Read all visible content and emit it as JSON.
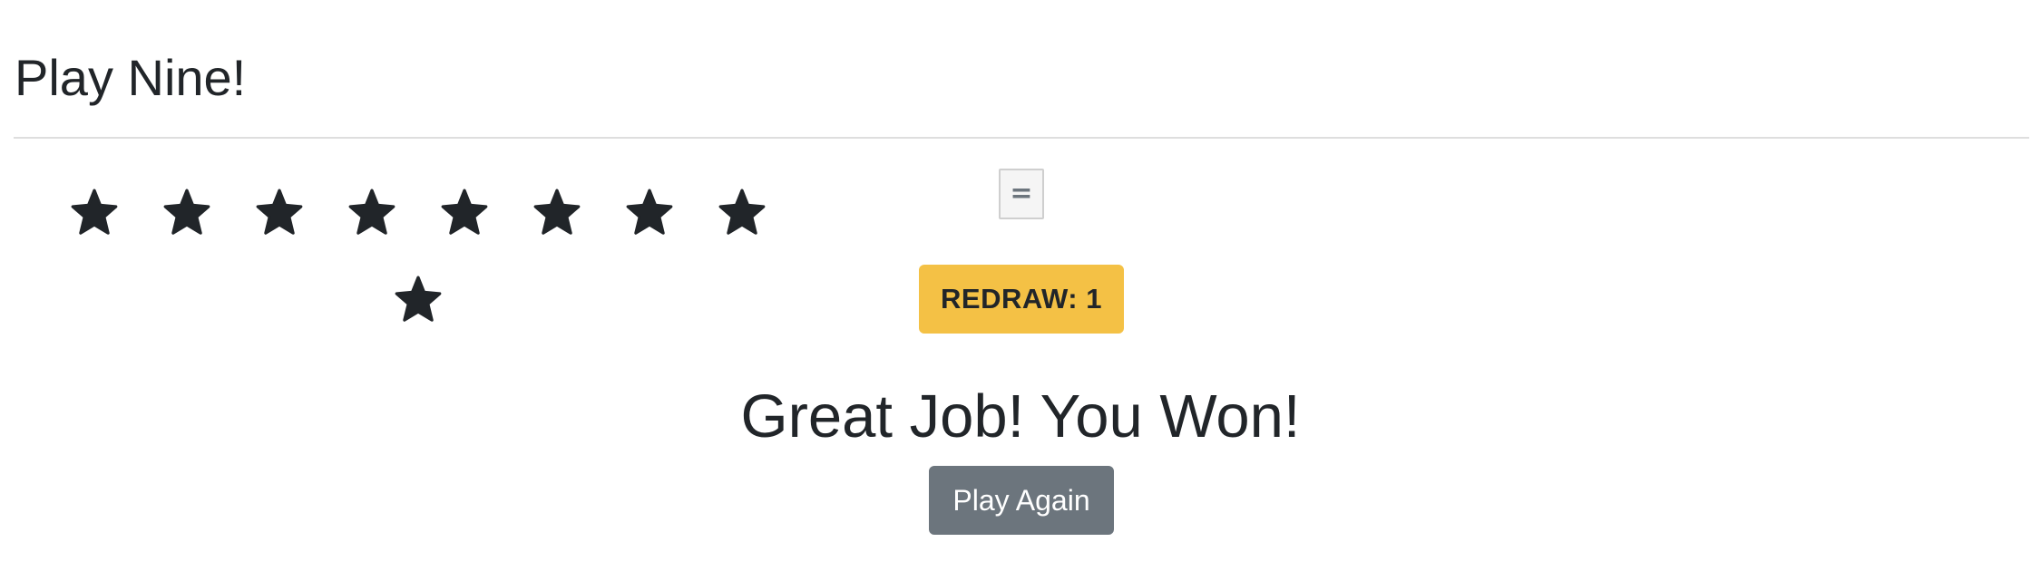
{
  "app": {
    "title": "Play Nine!"
  },
  "stars": {
    "count": 9,
    "icon": "star-icon",
    "color": "#212529"
  },
  "controls": {
    "equals_label": "=",
    "redraw_label": "REDRAW: 1",
    "redraw_color": "#f4c145"
  },
  "done_frame": {
    "message": "Great Job! You Won!",
    "play_again_label": "Play Again",
    "play_again_color": "#6c757d"
  }
}
